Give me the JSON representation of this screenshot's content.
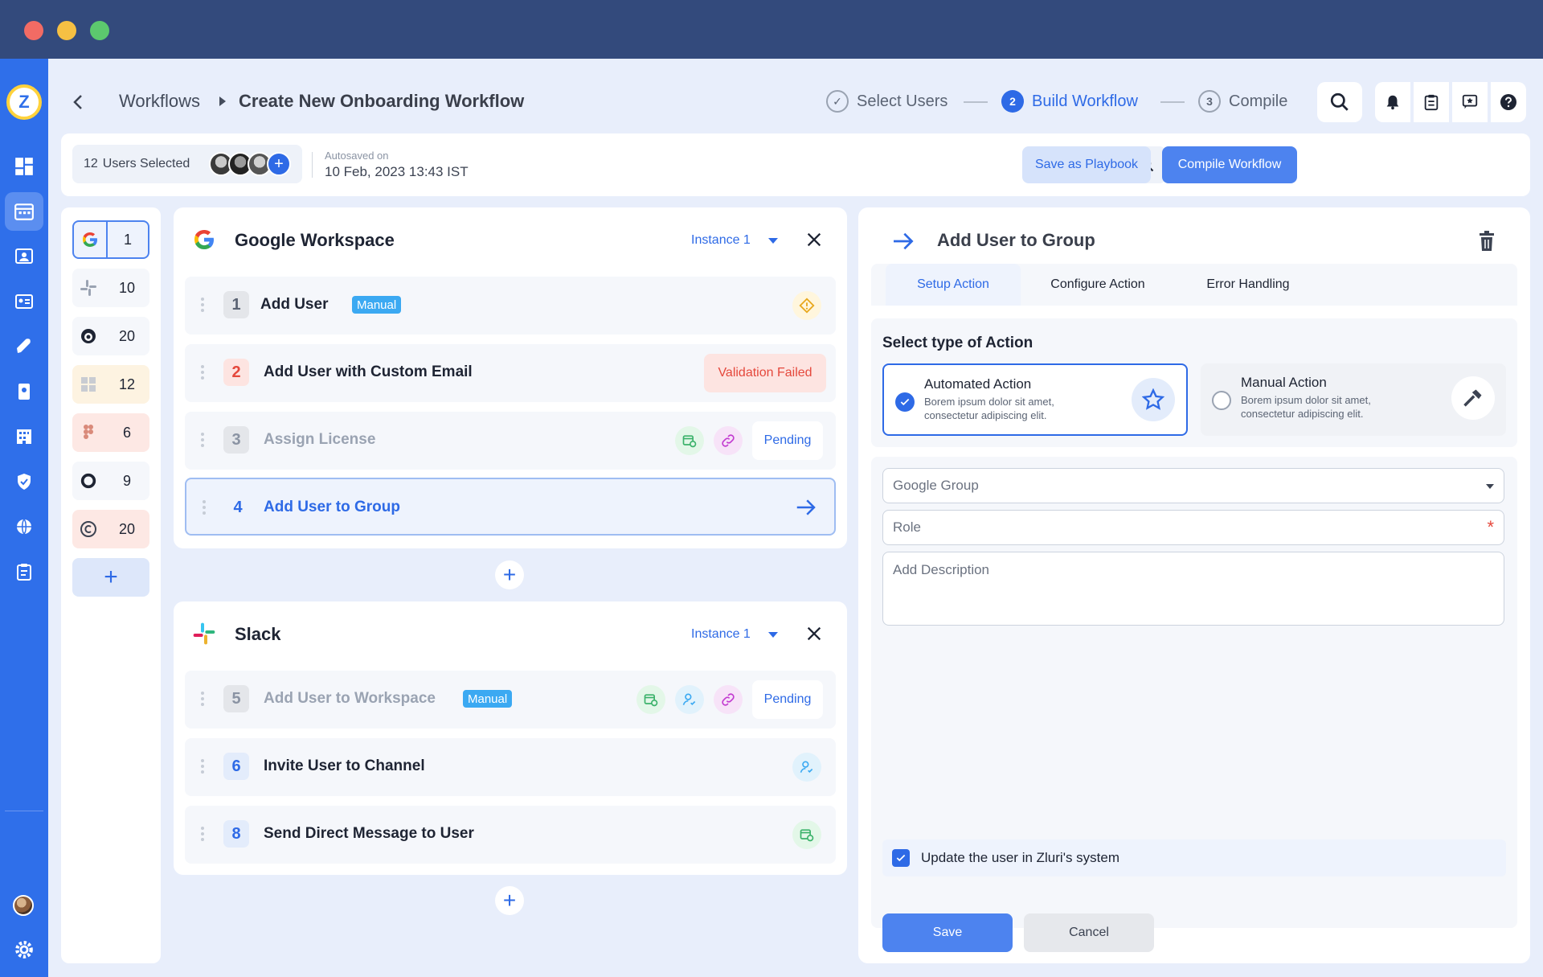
{
  "breadcrumb": {
    "root": "Workflows",
    "current": "Create New Onboarding Workflow"
  },
  "stepper": [
    {
      "label": "Select Users",
      "marker": "✓",
      "state": "done"
    },
    {
      "label": "Build Workflow",
      "marker": "2",
      "state": "active"
    },
    {
      "label": "Compile",
      "marker": "3",
      "state": "todo"
    }
  ],
  "toolbar": {
    "users_count": "12",
    "users_label": "Users Selected",
    "autosave_label": "Autosaved on",
    "autosave_value": "10 Feb, 2023 13:43  IST",
    "save_playbook": "Save as Playbook",
    "compile": "Compile Workflow"
  },
  "apps": [
    {
      "name": "google",
      "count": "1",
      "selected": true
    },
    {
      "name": "slack",
      "count": "10"
    },
    {
      "name": "mailchimp",
      "count": "20"
    },
    {
      "name": "windows",
      "count": "12"
    },
    {
      "name": "figma",
      "count": "6"
    },
    {
      "name": "circle-app",
      "count": "9"
    },
    {
      "name": "copyright-app",
      "count": "20"
    }
  ],
  "sections": [
    {
      "title": "Google Workspace",
      "instance": "Instance 1",
      "actions": [
        {
          "num": "1",
          "label": "Add User",
          "tag": "Manual",
          "status": "warning"
        },
        {
          "num": "2",
          "label": "Add User with Custom Email",
          "status_text": "Validation Failed"
        },
        {
          "num": "3",
          "label": "Assign License",
          "status_text": "Pending"
        },
        {
          "num": "4",
          "label": "Add User to Group",
          "selected": true
        }
      ]
    },
    {
      "title": "Slack",
      "instance": "Instance 1",
      "actions": [
        {
          "num": "5",
          "label": "Add User to Workspace",
          "tag": "Manual",
          "status_text": "Pending"
        },
        {
          "num": "6",
          "label": "Invite User to Channel"
        },
        {
          "num": "8",
          "label": "Send Direct Message to User"
        }
      ]
    }
  ],
  "detail": {
    "title": "Add User to Group",
    "tabs": [
      "Setup Action",
      "Configure Action",
      "Error Handling"
    ],
    "active_tab": "Setup Action",
    "select_type_title": "Select type of Action",
    "automated": {
      "title": "Automated Action",
      "desc": "Borem ipsum dolor sit amet, consectetur adipiscing elit.",
      "selected": true
    },
    "manual": {
      "title": "Manual Action",
      "desc": "Borem ipsum dolor sit amet, consectetur adipiscing elit.",
      "selected": false
    },
    "fields": {
      "group_placeholder": "Google Group",
      "role_placeholder": "Role",
      "role_required_mark": "*",
      "description_placeholder": "Add Description"
    },
    "update_checkbox": {
      "label": "Update the user in Zluri's system",
      "checked": true
    },
    "save": "Save",
    "cancel": "Cancel"
  },
  "logo_text": "Z",
  "colors": {
    "brand": "#2f6fea",
    "titlebar": "#334a7c",
    "error": "#e5483c",
    "tag": "#3ba9f2"
  }
}
